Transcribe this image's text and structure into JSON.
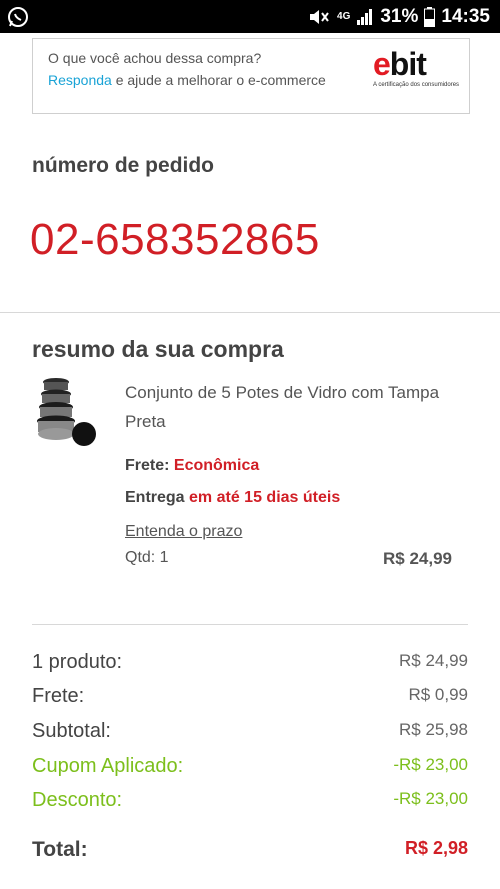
{
  "status_bar": {
    "battery": "31%",
    "time": "14:35",
    "network": "4G"
  },
  "ebit_banner": {
    "question": "O que você achou dessa compra?",
    "link": "Responda",
    "rest": " e ajude a melhorar o e-commerce",
    "logo_e": "e",
    "logo_rest": "bit",
    "tagline": "A certificação dos consumidores"
  },
  "order": {
    "label": "número de pedido",
    "number": "02-658352865"
  },
  "summary": {
    "title": "resumo da sua compra",
    "product_name": "Conjunto de 5 Potes de Vidro com Tampa Preta",
    "frete_label": "Frete:",
    "frete_value": "Econômica",
    "entrega_label": "Entrega",
    "entrega_value": "em até 15 dias úteis",
    "prazo_link": "Entenda o prazo",
    "qtd": "Qtd: 1",
    "price": "R$ 24,99"
  },
  "totals": {
    "rows": [
      {
        "label": "1 produto:",
        "value": "R$ 24,99"
      },
      {
        "label": "Frete:",
        "value": "R$ 0,99"
      },
      {
        "label": "Subtotal:",
        "value": "R$ 25,98"
      },
      {
        "label": "Cupom Aplicado:",
        "value": "-R$ 23,00"
      },
      {
        "label": "Desconto:",
        "value": "-R$ 23,00"
      }
    ],
    "total_label": "Total:",
    "total_value": "R$ 2,98"
  },
  "colors": {
    "accent_red": "#d11f26",
    "link_blue": "#1aa3d6",
    "discount_green": "#7cbf1c"
  }
}
